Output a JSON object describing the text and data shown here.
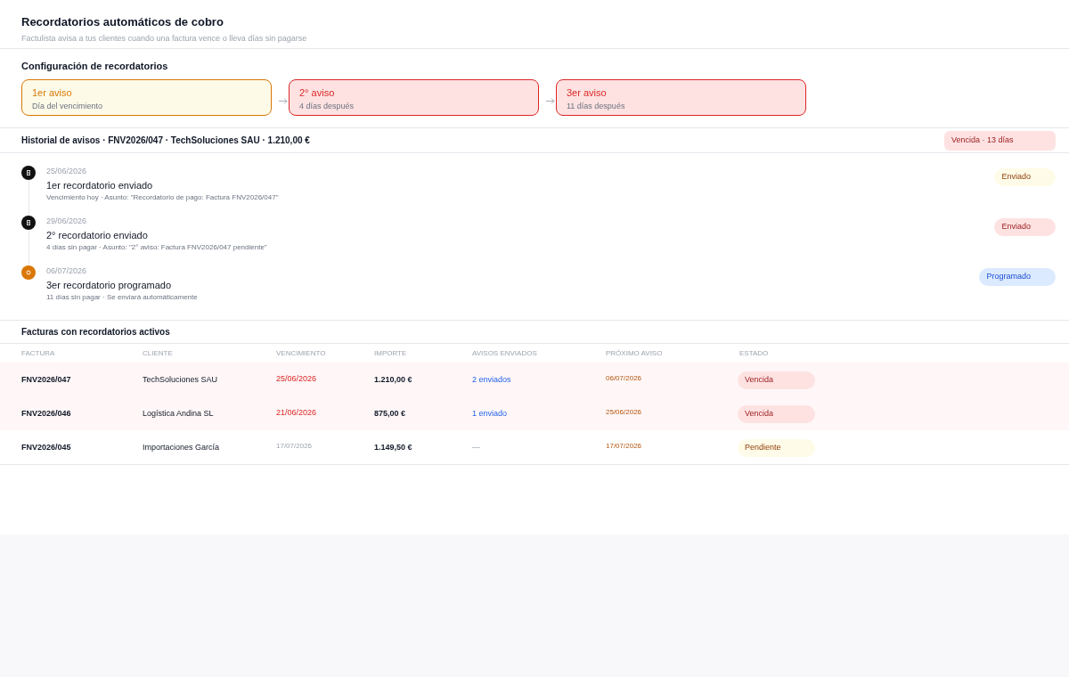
{
  "header": {
    "title": "Recordatorios automáticos de cobro",
    "subtitle": "Factulista avisa a tus clientes cuando una factura vence o lleva días sin pagarse"
  },
  "config": {
    "title": "Configuración de recordatorios",
    "steps": [
      {
        "label": "1er aviso",
        "detail": "Día del vencimiento",
        "kind": "warning"
      },
      {
        "label": "2° aviso",
        "detail": "4 días después",
        "kind": "danger"
      },
      {
        "label": "3er aviso",
        "detail": "11 días después",
        "kind": "danger"
      }
    ]
  },
  "history": {
    "title": "Historial de avisos · FNV2026/047 · TechSoluciones SAU · 1.210,00 €",
    "badge": {
      "text": "Vencida · 13 días",
      "kind": "danger"
    },
    "events": [
      {
        "kind": "sent",
        "date": "25/06/2026",
        "title": "1er recordatorio enviado",
        "detail": "Vencimiento hoy · Asunto: \"Recordatorio de pago: Factura FNV2026/047\"",
        "status": {
          "text": "Enviado",
          "kind": "warning"
        }
      },
      {
        "kind": "sent",
        "date": "29/06/2026",
        "title": "2° recordatorio enviado",
        "detail": "4 días sin pagar · Asunto: \"2° aviso: Factura FNV2026/047 pendiente\"",
        "status": {
          "text": "Enviado",
          "kind": "danger"
        }
      },
      {
        "kind": "scheduled",
        "date": "06/07/2026",
        "title": "3er recordatorio programado",
        "detail": "11 días sin pagar · Se enviará automáticamente",
        "status": {
          "text": "Programado",
          "kind": "info"
        }
      }
    ]
  },
  "table": {
    "title": "Facturas con recordatorios activos",
    "columns": [
      "FACTURA",
      "CLIENTE",
      "VENCIMIENTO",
      "IMPORTE",
      "AVISOS ENVIADOS",
      "PRÓXIMO AVISO",
      "ESTADO"
    ],
    "rows": [
      {
        "overdue": true,
        "invoice": "FNV2026/047",
        "client": "TechSoluciones SAU",
        "due_date": "25/06/2026",
        "amount": "1.210,00 €",
        "sent": {
          "text": "2 enviados",
          "link": true
        },
        "next_reminder": "06/07/2026",
        "status": {
          "text": "Vencida",
          "kind": "danger"
        }
      },
      {
        "overdue": true,
        "invoice": "FNV2026/046",
        "client": "Logística Andina SL",
        "due_date": "21/06/2026",
        "amount": "875,00 €",
        "sent": {
          "text": "1 enviado",
          "link": true
        },
        "next_reminder": "25/06/2026",
        "status": {
          "text": "Vencida",
          "kind": "danger"
        }
      },
      {
        "overdue": false,
        "invoice": "FNV2026/045",
        "client": "Importaciones García",
        "due_date": "17/07/2026",
        "amount": "1.149,50 €",
        "sent": {
          "text": "—",
          "link": false
        },
        "next_reminder": "17/07/2026",
        "status": {
          "text": "Pendiente",
          "kind": "warning"
        }
      }
    ]
  }
}
